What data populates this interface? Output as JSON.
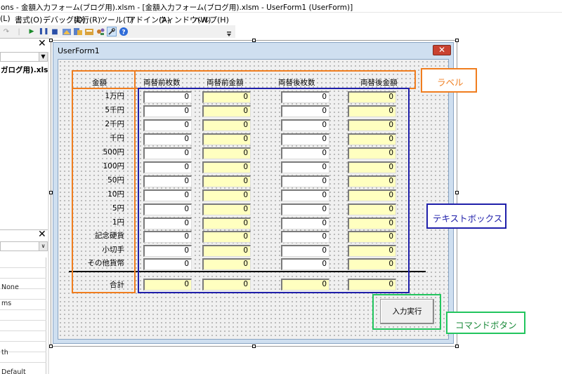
{
  "window": {
    "title": "ons - 金額入力フォーム(ブログ用).xlsm - [金額入力フォーム(ブログ用).xlsm - UserForm1 (UserForm)]"
  },
  "menu": {
    "items": [
      "(L)",
      "書式(O)",
      "デバッグ(D)",
      "実行(R)",
      "ツール(T)",
      "アドイン(A)",
      "ウィンドウ(W)",
      "ヘルプ(H)"
    ]
  },
  "toolbar": {
    "icons": [
      "redo-icon",
      "run-icon",
      "break-icon",
      "reset-icon",
      "design-mode-icon",
      "project-explorer-icon",
      "properties-icon",
      "object-browser-icon",
      "toolbox-icon",
      "help-icon"
    ]
  },
  "project_pane": {
    "item": "ガログ用).xlsm)"
  },
  "properties_pane": {
    "rows": [
      "None",
      "ms",
      "th",
      "Default"
    ]
  },
  "userform": {
    "caption": "UserForm1",
    "headers": [
      "金額",
      "両替前枚数",
      "両替前金額",
      "両替後枚数",
      "両替後金額"
    ],
    "rows": [
      {
        "label": "1万円",
        "values": [
          "0",
          "0",
          "0",
          "0"
        ]
      },
      {
        "label": "5千円",
        "values": [
          "0",
          "0",
          "0",
          "0"
        ]
      },
      {
        "label": "2千円",
        "values": [
          "0",
          "0",
          "0",
          "0"
        ]
      },
      {
        "label": "千円",
        "values": [
          "0",
          "0",
          "0",
          "0"
        ]
      },
      {
        "label": "500円",
        "values": [
          "0",
          "0",
          "0",
          "0"
        ]
      },
      {
        "label": "100円",
        "values": [
          "0",
          "0",
          "0",
          "0"
        ]
      },
      {
        "label": "50円",
        "values": [
          "0",
          "0",
          "0",
          "0"
        ]
      },
      {
        "label": "10円",
        "values": [
          "0",
          "0",
          "0",
          "0"
        ]
      },
      {
        "label": "5円",
        "values": [
          "0",
          "0",
          "0",
          "0"
        ]
      },
      {
        "label": "1円",
        "values": [
          "0",
          "0",
          "0",
          "0"
        ]
      },
      {
        "label": "記念硬貨",
        "values": [
          "0",
          "0",
          "0",
          "0"
        ]
      },
      {
        "label": "小切手",
        "values": [
          "0",
          "0",
          "0",
          "0"
        ]
      },
      {
        "label": "その他貨幣",
        "values": [
          "0",
          "0",
          "0",
          "0"
        ]
      }
    ],
    "total": {
      "label": "合計",
      "values": [
        "0",
        "0",
        "0",
        "0"
      ]
    },
    "button_label": "入力実行"
  },
  "annotations": {
    "label": {
      "text": "ラベル",
      "color": "#f07d1e"
    },
    "textbox": {
      "text": "テキストボックス",
      "color": "#1f1faa"
    },
    "command": {
      "text": "コマンドボタン",
      "color": "#22c55e"
    }
  },
  "colors": {
    "form_frame": "#cfdff0",
    "yellow_textbox": "#ffffc0",
    "close_button": "#c94230"
  }
}
